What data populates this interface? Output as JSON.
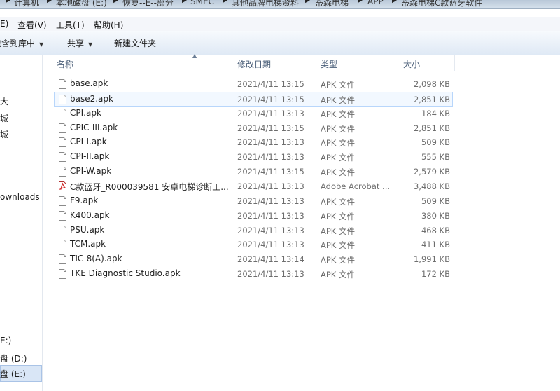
{
  "breadcrumb": {
    "segments": [
      "计算机",
      "本地磁盘 (E:)",
      "恢复--E--部分",
      "SMEC",
      "其他品牌电梯资料",
      "蒂森电梯",
      "APP",
      "蒂森电梯C款蓝牙软件"
    ]
  },
  "menubar": {
    "items": [
      "E)",
      "查看(V)",
      "工具(T)",
      "帮助(H)"
    ]
  },
  "toolbar": {
    "include_library": "包含到库中",
    "share": "共享",
    "new_folder": "新建文件夹"
  },
  "nav": {
    "items": [
      "大",
      "城",
      "城",
      "ownloads",
      "E:)",
      "盘 (D:)",
      "盘 (E:)"
    ]
  },
  "columns": {
    "name": "名称",
    "date": "修改日期",
    "type": "类型",
    "size": "大小"
  },
  "files": [
    {
      "name": "base.apk",
      "date": "2021/4/11 13:15",
      "type": "APK 文件",
      "size": "2,098 KB",
      "icon": "file-icon"
    },
    {
      "name": "base2.apk",
      "date": "2021/4/11 13:15",
      "type": "APK 文件",
      "size": "2,851 KB",
      "icon": "file-icon"
    },
    {
      "name": "CPI.apk",
      "date": "2021/4/11 13:13",
      "type": "APK 文件",
      "size": "184 KB",
      "icon": "file-icon"
    },
    {
      "name": "CPIC-III.apk",
      "date": "2021/4/11 13:15",
      "type": "APK 文件",
      "size": "2,851 KB",
      "icon": "file-icon"
    },
    {
      "name": "CPI-I.apk",
      "date": "2021/4/11 13:13",
      "type": "APK 文件",
      "size": "509 KB",
      "icon": "file-icon"
    },
    {
      "name": "CPI-II.apk",
      "date": "2021/4/11 13:13",
      "type": "APK 文件",
      "size": "555 KB",
      "icon": "file-icon"
    },
    {
      "name": "CPI-W.apk",
      "date": "2021/4/11 13:15",
      "type": "APK 文件",
      "size": "2,579 KB",
      "icon": "file-icon"
    },
    {
      "name": "C款蓝牙_R000039581 安卓电梯诊断工...",
      "date": "2021/4/11 13:13",
      "type": "Adobe Acrobat ...",
      "size": "3,488 KB",
      "icon": "pdf-icon"
    },
    {
      "name": "F9.apk",
      "date": "2021/4/11 13:13",
      "type": "APK 文件",
      "size": "509 KB",
      "icon": "file-icon"
    },
    {
      "name": "K400.apk",
      "date": "2021/4/11 13:13",
      "type": "APK 文件",
      "size": "380 KB",
      "icon": "file-icon"
    },
    {
      "name": "PSU.apk",
      "date": "2021/4/11 13:13",
      "type": "APK 文件",
      "size": "468 KB",
      "icon": "file-icon"
    },
    {
      "name": "TCM.apk",
      "date": "2021/4/11 13:13",
      "type": "APK 文件",
      "size": "411 KB",
      "icon": "file-icon"
    },
    {
      "name": "TIC-8(A).apk",
      "date": "2021/4/11 13:14",
      "type": "APK 文件",
      "size": "1,991 KB",
      "icon": "file-icon"
    },
    {
      "name": "TKE Diagnostic Studio.apk",
      "date": "2021/4/11 13:13",
      "type": "APK 文件",
      "size": "172 KB",
      "icon": "file-icon"
    }
  ],
  "colors": {
    "hover_border": "#b8d6fb",
    "selected_bg": "#d9e6f6",
    "pdf_red": "#d32f2f"
  }
}
